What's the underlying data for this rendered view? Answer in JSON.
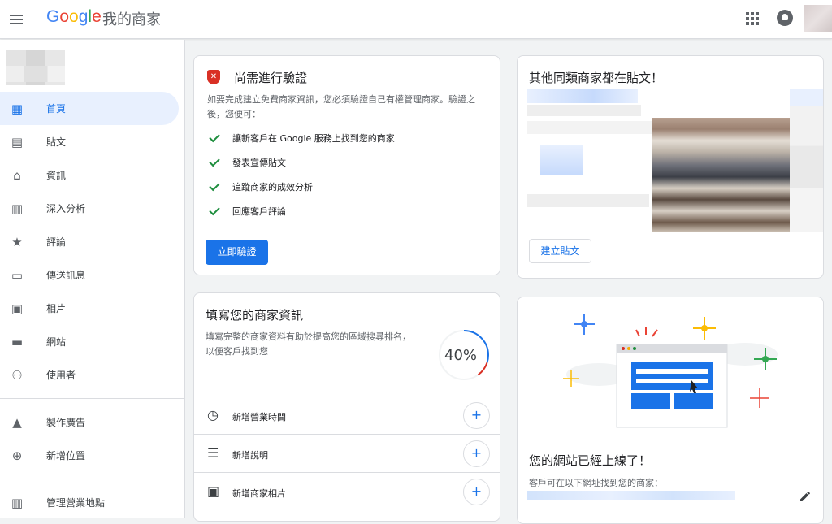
{
  "header": {
    "logo_letters": [
      {
        "ch": "G",
        "color": "#4285f4"
      },
      {
        "ch": "o",
        "color": "#ea4335"
      },
      {
        "ch": "o",
        "color": "#fbbc05"
      },
      {
        "ch": "g",
        "color": "#4285f4"
      },
      {
        "ch": "l",
        "color": "#34a853"
      },
      {
        "ch": "e",
        "color": "#ea4335"
      }
    ],
    "product_name": "我的商家",
    "icons": [
      "menu-icon",
      "apps-icon",
      "notifications-icon",
      "avatar"
    ]
  },
  "sidebar": {
    "items": [
      {
        "label": "首頁",
        "icon": "dashboard-icon",
        "glyph": "▦",
        "active": true
      },
      {
        "label": "貼文",
        "icon": "posts-icon",
        "glyph": "▤"
      },
      {
        "label": "資訊",
        "icon": "storefront-icon",
        "glyph": "⌂"
      },
      {
        "label": "深入分析",
        "icon": "insights-icon",
        "glyph": "▥"
      },
      {
        "label": "評論",
        "icon": "star-icon",
        "glyph": "★"
      },
      {
        "label": "傳送訊息",
        "icon": "message-icon",
        "glyph": "▭"
      },
      {
        "label": "相片",
        "icon": "photos-icon",
        "glyph": "▣"
      },
      {
        "label": "網站",
        "icon": "website-icon",
        "glyph": "▬"
      },
      {
        "label": "使用者",
        "icon": "add-user-icon",
        "glyph": "⚇"
      }
    ],
    "secondary_items": [
      {
        "label": "製作廣告",
        "icon": "ads-icon",
        "glyph": "▲"
      },
      {
        "label": "新增位置",
        "icon": "add-location-icon",
        "glyph": "⊕"
      }
    ],
    "tertiary_items": [
      {
        "label": "管理營業地點",
        "icon": "manage-locations-icon",
        "glyph": "▥"
      }
    ]
  },
  "verify_card": {
    "title": "尚需進行驗證",
    "description": "如要完成建立免費商家資訊，您必須驗證自己有權管理商家。驗證之後，您便可：",
    "benefits": [
      "讓新客戶在 Google 服務上找到您的商家",
      "發表宣傳貼文",
      "追蹤商家的成效分析",
      "回應客戶評論"
    ],
    "button_label": "立即驗證",
    "accent_color": "#1a73e8",
    "warning_color": "#d93025"
  },
  "posts_card": {
    "title": "其他同類商家都在貼文！",
    "button_label": "建立貼文"
  },
  "fill_card": {
    "title": "填寫您的商家資訊",
    "description": "填寫完整的商家資料有助於提高您的區域搜尋排名，以便客戶找到您",
    "progress_label": "40%",
    "progress_value": 0.4,
    "items": [
      {
        "label": "新增營業時間",
        "icon": "clock-icon",
        "glyph": "◷"
      },
      {
        "label": "新增說明",
        "icon": "description-icon",
        "glyph": "☰"
      },
      {
        "label": "新增商家相片",
        "icon": "add-photo-icon",
        "glyph": "▣"
      }
    ],
    "add_glyph": "+"
  },
  "site_card": {
    "title": "您的網站已經上線了！",
    "description": "客戶可在以下網址找到您的商家："
  }
}
